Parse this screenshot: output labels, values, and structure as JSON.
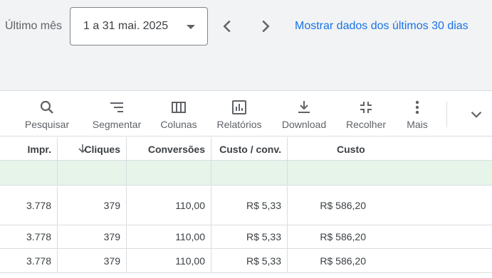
{
  "header": {
    "period_label": "Último mês",
    "date_range": "1 a 31 mai. 2025",
    "show_last_link": "Mostrar dados dos últimos 30 dias"
  },
  "toolbar": {
    "items": [
      {
        "label": "Pesquisar",
        "icon": "search-icon"
      },
      {
        "label": "Segmentar",
        "icon": "segment-icon"
      },
      {
        "label": "Colunas",
        "icon": "columns-icon"
      },
      {
        "label": "Relatórios",
        "icon": "reports-icon"
      },
      {
        "label": "Download",
        "icon": "download-icon"
      },
      {
        "label": "Recolher",
        "icon": "collapse-icon"
      },
      {
        "label": "Mais",
        "icon": "more-vert-icon"
      }
    ]
  },
  "table": {
    "columns": [
      "Impr.",
      "Cliques",
      "Conversões",
      "Custo / conv.",
      "Custo"
    ],
    "sorted_column": "Cliques",
    "rows": [
      [
        "3.778",
        "379",
        "110,00",
        "R$ 5,33",
        "R$ 586,20"
      ],
      [
        "3.778",
        "379",
        "110,00",
        "R$ 5,33",
        "R$ 586,20"
      ],
      [
        "3.778",
        "379",
        "110,00",
        "R$ 5,33",
        "R$ 586,20"
      ]
    ]
  },
  "colors": {
    "accent": "#1a73e8",
    "total_row": "#e6f4ea",
    "top_band": "#f1f3f4"
  }
}
